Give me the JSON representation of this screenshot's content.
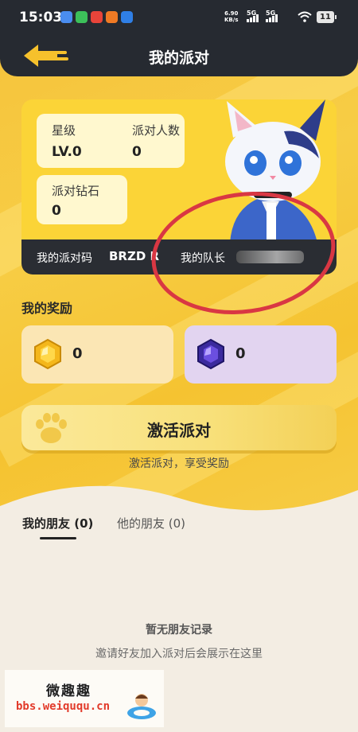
{
  "status_bar": {
    "time": "15:03",
    "net_speed": "6.90",
    "net_unit": "KB/s",
    "sim1": "5G",
    "sim2": "5G",
    "battery": "11"
  },
  "header": {
    "title": "我的派对",
    "back_icon": "back-arrow-icon"
  },
  "party_card": {
    "star_label": "星级",
    "star_value": "LV.0",
    "members_label": "派对人数",
    "members_value": "0",
    "diamond_label": "派对钻石",
    "diamond_value": "0",
    "code_label": "我的派对码",
    "code_value": "BRZD R",
    "captain_label": "我的队长"
  },
  "rewards": {
    "title": "我的奖励",
    "gold_value": "0",
    "purple_value": "0",
    "gold_icon": "gold-gem-icon",
    "purple_icon": "purple-gem-icon"
  },
  "activate": {
    "button_label": "激活派对",
    "subtitle": "激活派对，享受奖励",
    "icon": "paw-icon"
  },
  "friends": {
    "tab_mine": "我的朋友 (0)",
    "tab_theirs": "他的朋友 (0)",
    "empty_title": "暂无朋友记录",
    "empty_sub": "邀请好友加入派对后会展示在这里"
  },
  "watermark": {
    "name": "微趣趣",
    "url": "bbs.weiququ.cn"
  },
  "colors": {
    "accent_yellow": "#fbd437",
    "header_dark": "#262a31",
    "annotation_red": "#d93743"
  }
}
